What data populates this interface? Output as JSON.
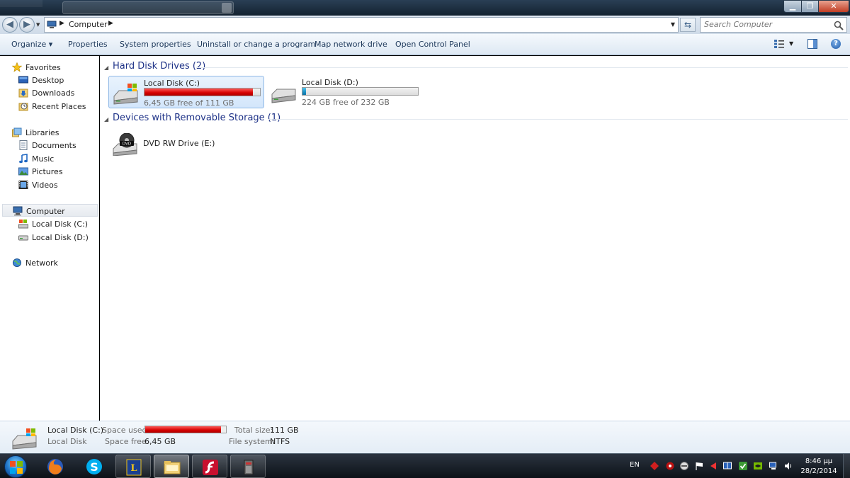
{
  "address": {
    "crumb": "Computer",
    "search_placeholder": "Search Computer"
  },
  "toolbar": {
    "organize": "Organize ▾",
    "properties": "Properties",
    "system_properties": "System properties",
    "uninstall": "Uninstall or change a program",
    "map_network_drive": "Map network drive",
    "open_control_panel": "Open Control Panel"
  },
  "nav": {
    "favorites": "Favorites",
    "desktop": "Desktop",
    "downloads": "Downloads",
    "recent_places": "Recent Places",
    "libraries": "Libraries",
    "documents": "Documents",
    "music": "Music",
    "pictures": "Pictures",
    "videos": "Videos",
    "computer": "Computer",
    "local_c": "Local Disk (C:)",
    "local_d": "Local Disk (D:)",
    "network": "Network"
  },
  "content": {
    "group_hdd": "Hard Disk Drives (2)",
    "group_removable": "Devices with Removable Storage (1)",
    "drives": [
      {
        "name": "Local Disk (C:)",
        "free": "6,45 GB free of 111 GB",
        "used_fraction": 0.94
      },
      {
        "name": "Local Disk (D:)",
        "free": "224 GB free of 232 GB",
        "used_fraction": 0.03
      }
    ],
    "dvd": {
      "name": "DVD RW Drive (E:)"
    }
  },
  "details": {
    "name": "Local Disk (C:)",
    "type": "Local Disk",
    "space_used_label": "Space used:",
    "space_free_label": "Space free:",
    "space_free": "6,45 GB",
    "total_size_label": "Total size:",
    "total_size": "111 GB",
    "file_system_label": "File system:",
    "file_system": "NTFS",
    "used_fraction": 0.94
  },
  "taskbar": {
    "language": "EN",
    "time": "8:46 μμ",
    "date": "28/2/2014"
  },
  "colors": {
    "used_red": "#d40000",
    "used_blue": "#1c8fc3",
    "group_header": "#1e3287"
  }
}
